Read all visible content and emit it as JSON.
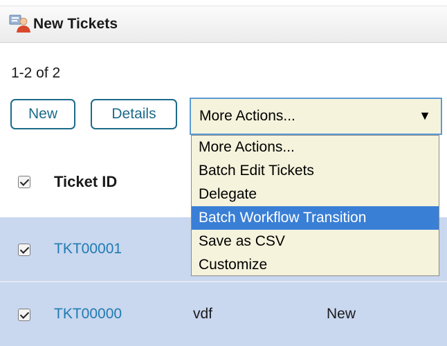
{
  "panel": {
    "title": "New Tickets",
    "record_count": "1-2 of 2"
  },
  "toolbar": {
    "new_label": "New",
    "details_label": "Details",
    "more_actions": {
      "selected": "More Actions...",
      "options": [
        "More Actions...",
        "Batch Edit Tickets",
        "Delegate",
        "Batch Workflow Transition",
        "Save as CSV",
        "Customize"
      ],
      "highlighted": "Batch Workflow Transition"
    }
  },
  "table": {
    "columns": [
      "Ticket ID"
    ],
    "rows": [
      {
        "id": "TKT00001",
        "col2": "",
        "col3": "",
        "checked": true
      },
      {
        "id": "TKT00000",
        "col2": "vdf",
        "col3": "New",
        "checked": true
      }
    ]
  },
  "colors": {
    "accent": "#1b6a8a",
    "link": "#1f7bb0",
    "row_selected": "#c9d7ef",
    "dropdown_bg": "#f5f3dc",
    "highlight": "#3a7fd6"
  },
  "icons": {
    "header": "tickets-user-icon",
    "dropdown": "triangle-down-icon",
    "checkbox": "checkbox-checked-icon"
  }
}
